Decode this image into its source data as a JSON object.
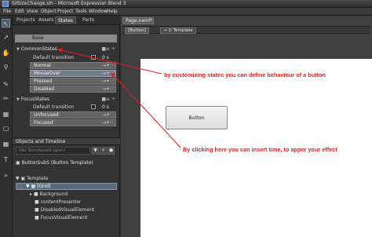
{
  "window": {
    "title": "SilSizeChange.sln - Microsoft Expression Blend 3"
  },
  "menu": [
    "File",
    "Edit",
    "View",
    "Object",
    "Project",
    "Tools",
    "Window",
    "Help"
  ],
  "tabs": [
    "Projects",
    "Assets",
    "States",
    "Parts"
  ],
  "active_tab": "States",
  "states": {
    "base": "Base",
    "groups": [
      {
        "name": "CommonStates",
        "default_transition": "Default transition",
        "time": "0 s",
        "items": [
          "Normal",
          "MouseOver",
          "Pressed",
          "Disabled"
        ],
        "selected": "MouseOver"
      },
      {
        "name": "FocusStates",
        "default_transition": "Default transition",
        "time": "0 s",
        "items": [
          "Unfocused",
          "Focused"
        ]
      }
    ]
  },
  "objects": {
    "header": "Objects and Timeline",
    "storyboard_placeholder": "(No Storyboard open)",
    "template_title": "ButtonSubS (Button Template)",
    "tree": [
      "Template",
      "[Grid]",
      "Background",
      "contentPresenter",
      "DisabledVisualElement",
      "FocusVisualElement"
    ]
  },
  "document": {
    "tab": "Page.xaml*",
    "breadcrumb": [
      "[Button]",
      "Template"
    ]
  },
  "canvas": {
    "button_label": "Button",
    "annotation_states": "by customizing states you can define behaviour of a button",
    "annotation_time": "By clicking here you can insert time, to apper your effect"
  },
  "colors": {
    "annotation": "#e02020",
    "canvas": "#ffffff",
    "selection": "#707c8c"
  },
  "icons": [
    "select-tool-icon",
    "direct-select-icon",
    "hand-icon",
    "zoom-icon",
    "pen-icon",
    "brush-icon",
    "gradient-icon",
    "rectangle-icon",
    "grid-icon",
    "textblock-icon",
    "asset-icon"
  ]
}
